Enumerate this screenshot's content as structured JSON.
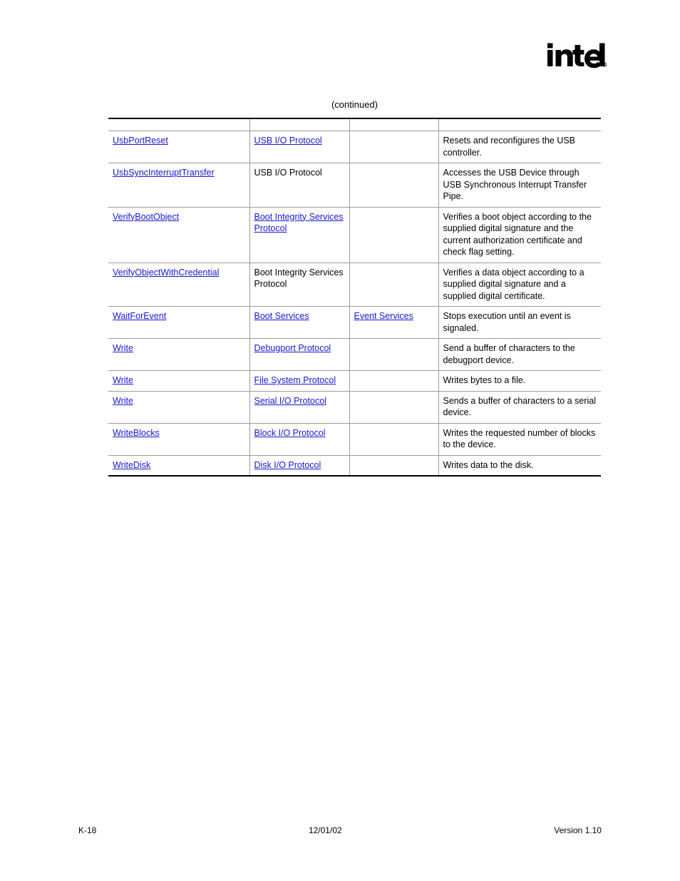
{
  "header": {
    "logo_alt": "intel",
    "logo_wordmark": "intel",
    "logo_trademark": "®"
  },
  "caption": "(continued)",
  "table": {
    "columns": [
      "",
      "",
      "",
      ""
    ],
    "rows": [
      {
        "name": "UsbPortReset",
        "name_is_link": true,
        "protocol": "USB I/O Protocol",
        "protocol_is_link": true,
        "service": "",
        "service_is_link": false,
        "description": "Resets and reconfigures the USB controller."
      },
      {
        "name": "UsbSyncInterruptTransfer",
        "name_is_link": true,
        "protocol": "USB I/O Protocol",
        "protocol_is_link": false,
        "service": "",
        "service_is_link": false,
        "description": "Accesses the USB Device through USB Synchronous Interrupt Transfer Pipe."
      },
      {
        "name": "VerifyBootObject",
        "name_is_link": true,
        "protocol": "Boot Integrity Services Protocol",
        "protocol_is_link": true,
        "service": "",
        "service_is_link": false,
        "description": "Verifies a boot object according to the supplied digital signature and the current authorization certificate and check flag setting."
      },
      {
        "name": "VerifyObjectWithCredential",
        "name_is_link": true,
        "protocol": "Boot Integrity Services Protocol",
        "protocol_is_link": false,
        "service": "",
        "service_is_link": false,
        "description": "Verifies a data object according to a supplied digital signature and a supplied digital certificate."
      },
      {
        "name": "WaitForEvent",
        "name_is_link": true,
        "protocol": "Boot Services",
        "protocol_is_link": true,
        "service": "Event Services",
        "service_is_link": true,
        "description": "Stops execution until an event is signaled."
      },
      {
        "name": "Write",
        "name_is_link": true,
        "protocol": "Debugport Protocol",
        "protocol_is_link": true,
        "service": "",
        "service_is_link": false,
        "description": "Send a buffer of characters to the debugport device."
      },
      {
        "name": "Write",
        "name_is_link": true,
        "protocol": "File System Protocol",
        "protocol_is_link": true,
        "service": "",
        "service_is_link": false,
        "description": "Writes bytes to a file."
      },
      {
        "name": "Write",
        "name_is_link": true,
        "protocol": "Serial I/O Protocol",
        "protocol_is_link": true,
        "service": "",
        "service_is_link": false,
        "description": "Sends a buffer of characters to a serial device."
      },
      {
        "name": "WriteBlocks",
        "name_is_link": true,
        "protocol": "Block I/O Protocol",
        "protocol_is_link": true,
        "service": "",
        "service_is_link": false,
        "description": "Writes the requested number of blocks to the device."
      },
      {
        "name": "WriteDisk",
        "name_is_link": true,
        "protocol": "Disk I/O Protocol",
        "protocol_is_link": true,
        "service": "",
        "service_is_link": false,
        "description": "Writes data to the disk."
      }
    ]
  },
  "footer": {
    "page_number": "K-18",
    "date": "12/01/02",
    "version": "Version 1.10"
  },
  "colors": {
    "link": "#1717d0",
    "text": "#000000",
    "rule": "#9a9a9a",
    "heavy_rule": "#000000",
    "background": "#ffffff"
  }
}
